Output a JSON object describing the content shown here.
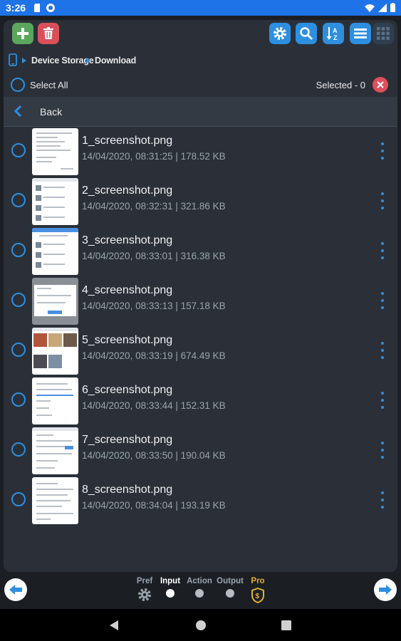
{
  "status_bar": {
    "time": "3:26"
  },
  "toolbar": {
    "add_button": "plus-icon",
    "delete_button": "trash-icon",
    "settings_button": "gear-icon",
    "search_button": "search-icon",
    "sort_button": "sort-az-icon",
    "list_view_button": "list-icon",
    "grid_view_button": "grid-icon"
  },
  "breadcrumb": {
    "root": "Device Storage",
    "current": "Download"
  },
  "select_bar": {
    "select_all": "Select All",
    "selected": "Selected - 0"
  },
  "back": {
    "label": "Back"
  },
  "files": [
    {
      "name": "1_screenshot.png",
      "meta": "14/04/2020, 08:31:25 | 178.52 KB"
    },
    {
      "name": "2_screenshot.png",
      "meta": "14/04/2020, 08:32:31 | 321.86 KB"
    },
    {
      "name": "3_screenshot.png",
      "meta": "14/04/2020, 08:33:01 | 316.38 KB"
    },
    {
      "name": "4_screenshot.png",
      "meta": "14/04/2020, 08:33:13 | 157.18 KB"
    },
    {
      "name": "5_screenshot.png",
      "meta": "14/04/2020, 08:33:19 | 674.49 KB"
    },
    {
      "name": "6_screenshot.png",
      "meta": "14/04/2020, 08:33:44 | 152.31 KB"
    },
    {
      "name": "7_screenshot.png",
      "meta": "14/04/2020, 08:33:50 | 190.04 KB"
    },
    {
      "name": "8_screenshot.png",
      "meta": "14/04/2020, 08:34:04 | 193.19 KB"
    }
  ],
  "wizard": {
    "steps": [
      {
        "label": "Pref",
        "state": "default"
      },
      {
        "label": "Input",
        "state": "active"
      },
      {
        "label": "Action",
        "state": "default"
      },
      {
        "label": "Output",
        "state": "default"
      },
      {
        "label": "Pro",
        "state": "pro"
      }
    ]
  },
  "colors": {
    "accent": "#2e8fe0",
    "add": "#5aa65d",
    "delete": "#d9505a",
    "status_bar": "#1e73e8"
  }
}
